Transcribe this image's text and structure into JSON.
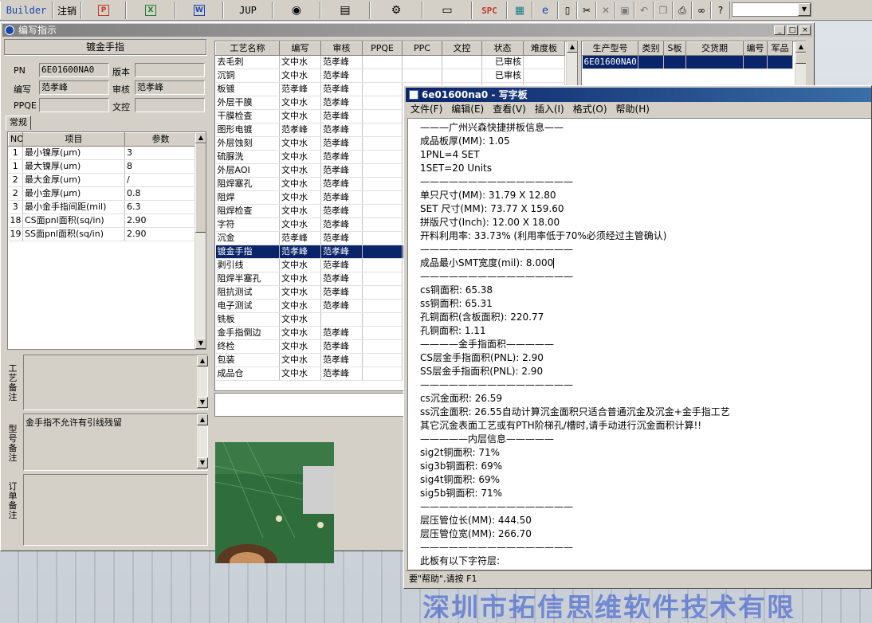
{
  "toolbar": {
    "builder": "Builder",
    "logout": "注销",
    "jup": "JUP",
    "spc": "SPC",
    "icons": [
      "powerpoint-icon",
      "excel-icon",
      "word-icon",
      "eye-icon",
      "database-icon",
      "network-icon",
      "computer-icon",
      "calculator-icon",
      "ie-icon",
      "new-doc-icon",
      "cut-icon",
      "close-icon",
      "save-icon",
      "undo-icon",
      "copy-icon",
      "print-icon",
      "binoculars-icon",
      "help-icon"
    ]
  },
  "main_window": {
    "title": "编写指示"
  },
  "left_panel": {
    "process_title": "镀金手指",
    "pn_label": "PN",
    "pn_value": "6E01600NA0",
    "version_label": "版本",
    "version_value": "",
    "writer_label": "编写",
    "writer_value": "范孝峰",
    "reviewer_label": "审核",
    "reviewer_value": "范孝峰",
    "ppqe_label": "PPQE",
    "ppqe_value": "",
    "wenkong_label": "文控",
    "wenkong_value": "",
    "tab_label": "常规",
    "params_headers": [
      "NO",
      "项目",
      "参数"
    ],
    "params": [
      [
        "1",
        "最小镍厚(μm)",
        "3"
      ],
      [
        "1",
        "最大镍厚(um)",
        "8"
      ],
      [
        "2",
        "最大金厚(um)",
        "/"
      ],
      [
        "2",
        "最小金厚(μm)",
        "0.8"
      ],
      [
        "3",
        "最小金手指间距(mil)",
        "6.3"
      ],
      [
        "18",
        "CS面pnl面积(sq/in)",
        "2.90"
      ],
      [
        "19",
        "SS面pnl面积(sq/in)",
        "2.90"
      ]
    ],
    "process_remark_label": "工艺备注",
    "model_remark_label": "型号备注",
    "model_remark_text": "金手指不允许有引线残留",
    "order_remark_label": "订单备注"
  },
  "process_table": {
    "headers": [
      "工艺名称",
      "编写",
      "审核",
      "PPQE",
      "PPC",
      "文控",
      "状态",
      "难度板"
    ],
    "rows": [
      [
        "去毛刺",
        "文中水",
        "范孝峰",
        "",
        "",
        "",
        "已审核",
        ""
      ],
      [
        "沉铜",
        "文中水",
        "范孝峰",
        "",
        "",
        "",
        "已审核",
        ""
      ],
      [
        "板镀",
        "范孝峰",
        "范孝峰",
        "",
        "",
        "",
        "",
        ""
      ],
      [
        "外层干膜",
        "文中水",
        "范孝峰",
        "",
        "",
        "",
        "",
        ""
      ],
      [
        "干膜检查",
        "文中水",
        "范孝峰",
        "",
        "",
        "",
        "",
        ""
      ],
      [
        "图形电镀",
        "范孝峰",
        "范孝峰",
        "",
        "",
        "",
        "",
        ""
      ],
      [
        "外层蚀刻",
        "文中水",
        "范孝峰",
        "",
        "",
        "",
        "",
        ""
      ],
      [
        "硫脲洗",
        "文中水",
        "范孝峰",
        "",
        "",
        "",
        "",
        ""
      ],
      [
        "外层AOI",
        "文中水",
        "范孝峰",
        "",
        "",
        "",
        "",
        ""
      ],
      [
        "阻焊塞孔",
        "文中水",
        "范孝峰",
        "",
        "",
        "",
        "",
        ""
      ],
      [
        "阻焊",
        "文中水",
        "范孝峰",
        "",
        "",
        "",
        "",
        ""
      ],
      [
        "阻焊检查",
        "文中水",
        "范孝峰",
        "",
        "",
        "",
        "",
        ""
      ],
      [
        "字符",
        "文中水",
        "范孝峰",
        "",
        "",
        "",
        "",
        ""
      ],
      [
        "沉金",
        "范孝峰",
        "范孝峰",
        "",
        "",
        "",
        "",
        ""
      ],
      [
        "镀金手指",
        "范孝峰",
        "范孝峰",
        "",
        "",
        "",
        "",
        ""
      ],
      [
        "剥引线",
        "文中水",
        "范孝峰",
        "",
        "",
        "",
        "",
        ""
      ],
      [
        "阻焊半塞孔",
        "文中水",
        "范孝峰",
        "",
        "",
        "",
        "",
        ""
      ],
      [
        "阻抗测试",
        "文中水",
        "范孝峰",
        "",
        "",
        "",
        "",
        ""
      ],
      [
        "电子测试",
        "文中水",
        "范孝峰",
        "",
        "",
        "",
        "",
        ""
      ],
      [
        "铣板",
        "文中水",
        "",
        "",
        "",
        "",
        "",
        ""
      ],
      [
        "金手指倒边",
        "文中水",
        "范孝峰",
        "",
        "",
        "",
        "",
        ""
      ],
      [
        "终检",
        "文中水",
        "范孝峰",
        "",
        "",
        "",
        "",
        ""
      ],
      [
        "包装",
        "文中水",
        "范孝峰",
        "",
        "",
        "",
        "",
        ""
      ],
      [
        "成品仓",
        "文中水",
        "范孝峰",
        "",
        "",
        "",
        "",
        ""
      ]
    ],
    "selected_index": 14
  },
  "right_table": {
    "headers": [
      "生产型号",
      "类别",
      "S板",
      "交货期",
      "编号",
      "军品"
    ],
    "rows": [
      [
        "6E01600NA0",
        "",
        "",
        "",
        "",
        ""
      ]
    ]
  },
  "wordpad": {
    "title": "6e01600na0 - 写字板",
    "menu": [
      "文件(F)",
      "编辑(E)",
      "查看(V)",
      "插入(I)",
      "格式(O)",
      "帮助(H)"
    ],
    "lines": [
      "———广州兴森快捷拼板信息——",
      "成品板厚(MM): 1.05",
      "1PNL=4 SET",
      "1SET=20 Units",
      "————————————————",
      "单只尺寸(MM): 31.79 X 12.80",
      "SET 尺寸(MM): 73.77 X 159.60",
      "拼版尺寸(Inch): 12.00 X 18.00",
      "开料利用率: 33.73% (利用率低于70%必须经过主管确认)",
      "————————————————",
      "成品最小SMT宽度(mil): 8.000",
      "————————————————",
      "cs铜面积: 65.38",
      "ss铜面积: 65.31",
      "孔铜面积(含板面积): 220.77",
      "孔铜面积: 1.11",
      "————金手指面积—————",
      "CS层金手指面积(PNL): 2.90",
      "SS层金手指面积(PNL): 2.90",
      "————————————————",
      "cs沉金面积: 26.59",
      "ss沉金面积: 26.55自动计算沉金面积只适合普通沉金及沉金+金手指工艺",
      "其它沉金表面工艺或有PTH阶梯孔/槽时,请手动进行沉金面积计算!!",
      "—————内层信息—————",
      "sig2t铜面积: 71%",
      "sig3b铜面积: 69%",
      "sig4t铜面积: 69%",
      "sig5b铜面积: 71%",
      "————————————————",
      "层压管位长(MM): 444.50",
      "层压管位宽(MM): 266.70",
      "————————————————",
      "此板有以下字符层:"
    ],
    "status": "要\"帮助\",请按 F1"
  },
  "background_watermark": "深圳市拓信思维软件技术有限"
}
